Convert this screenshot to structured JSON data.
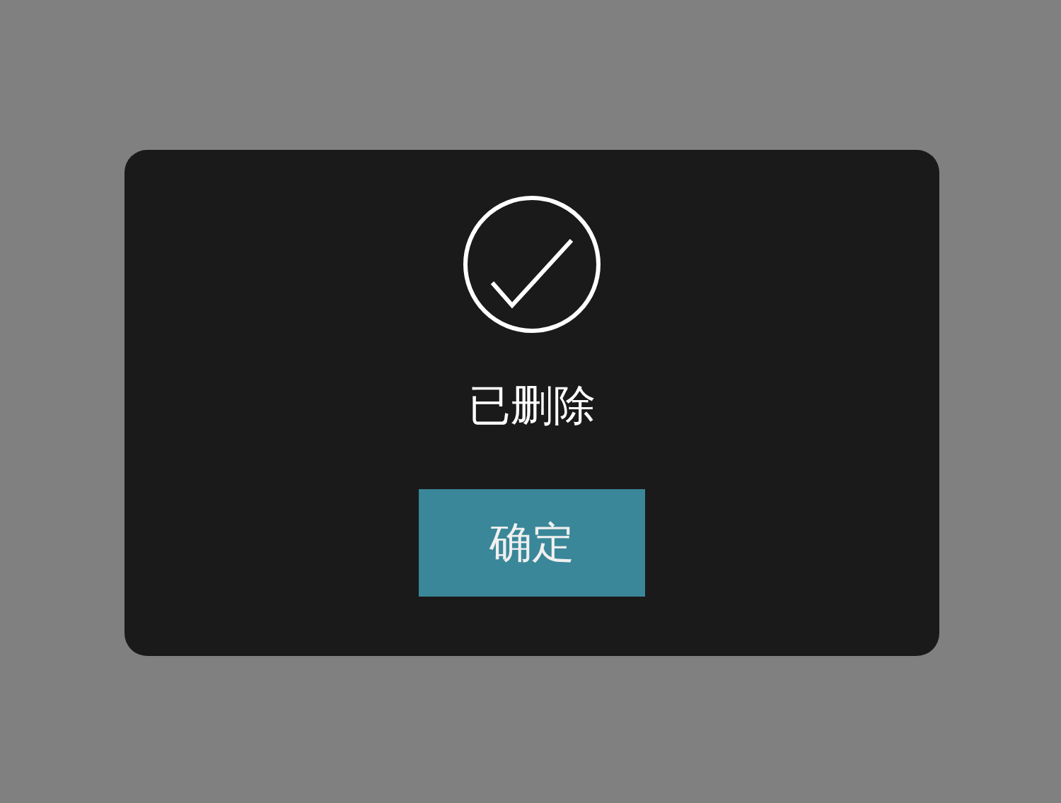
{
  "dialog": {
    "message": "已删除",
    "buttons": [
      "确定"
    ]
  }
}
